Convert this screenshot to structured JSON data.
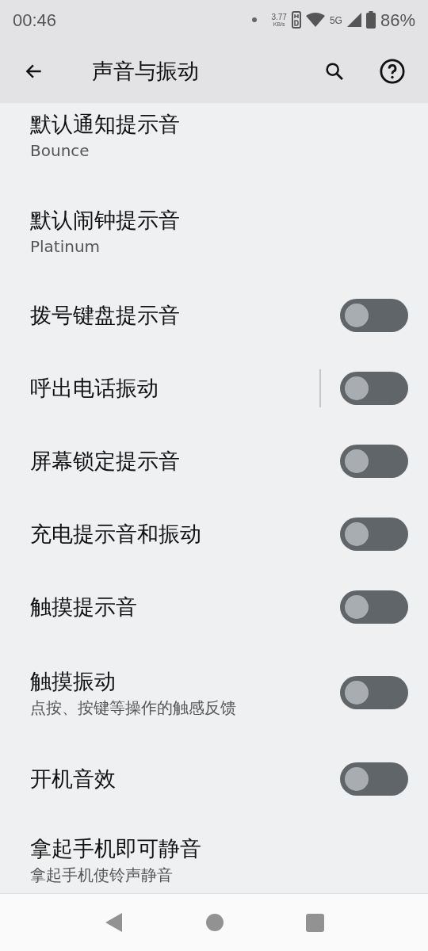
{
  "status_bar": {
    "time": "00:46",
    "speed": "3.77",
    "speed_unit": "KB/s",
    "network": "5G",
    "battery": "86%"
  },
  "app_bar": {
    "title": "声音与振动"
  },
  "items": [
    {
      "kind": "link",
      "title": "默认通知提示音",
      "subtitle": "Bounce"
    },
    {
      "kind": "link",
      "title": "默认闹钟提示音",
      "subtitle": "Platinum"
    },
    {
      "kind": "switch",
      "title": "拨号键盘提示音",
      "on": false,
      "separator": false
    },
    {
      "kind": "switch",
      "title": "呼出电话振动",
      "on": false,
      "separator": true
    },
    {
      "kind": "switch",
      "title": "屏幕锁定提示音",
      "on": false,
      "separator": false
    },
    {
      "kind": "switch",
      "title": "充电提示音和振动",
      "on": false,
      "separator": false
    },
    {
      "kind": "switch",
      "title": "触摸提示音",
      "on": false,
      "separator": false
    },
    {
      "kind": "switch",
      "title": "触摸振动",
      "subtitle": "点按、按键等操作的触感反馈",
      "on": false,
      "separator": false
    },
    {
      "kind": "switch",
      "title": "开机音效",
      "on": false,
      "separator": false
    },
    {
      "kind": "link",
      "title": "拿起手机即可静音",
      "subtitle": "拿起手机使铃声静音"
    }
  ]
}
